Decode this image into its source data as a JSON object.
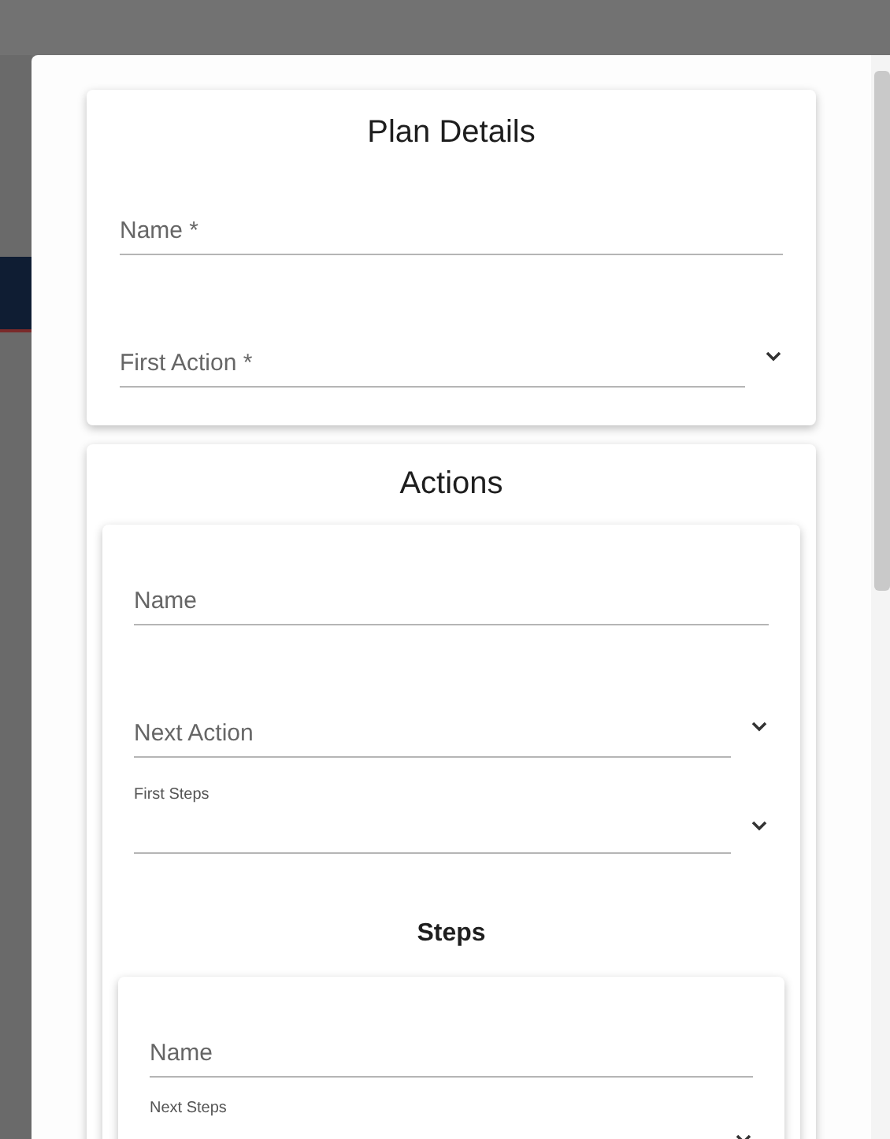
{
  "plan_details": {
    "title": "Plan Details",
    "fields": [
      {
        "kind": "text",
        "placeholder": "Name *"
      },
      {
        "kind": "select",
        "placeholder": "First Action *"
      }
    ]
  },
  "actions": {
    "title": "Actions",
    "action": {
      "fields": [
        {
          "kind": "text",
          "placeholder": "Name"
        },
        {
          "kind": "select",
          "placeholder": "Next Action"
        },
        {
          "kind": "select",
          "label": "First Steps"
        }
      ],
      "steps": {
        "title": "Steps",
        "step": {
          "fields": [
            {
              "kind": "text",
              "placeholder": "Name"
            },
            {
              "kind": "select",
              "label": "Next Steps"
            }
          ]
        }
      }
    }
  }
}
